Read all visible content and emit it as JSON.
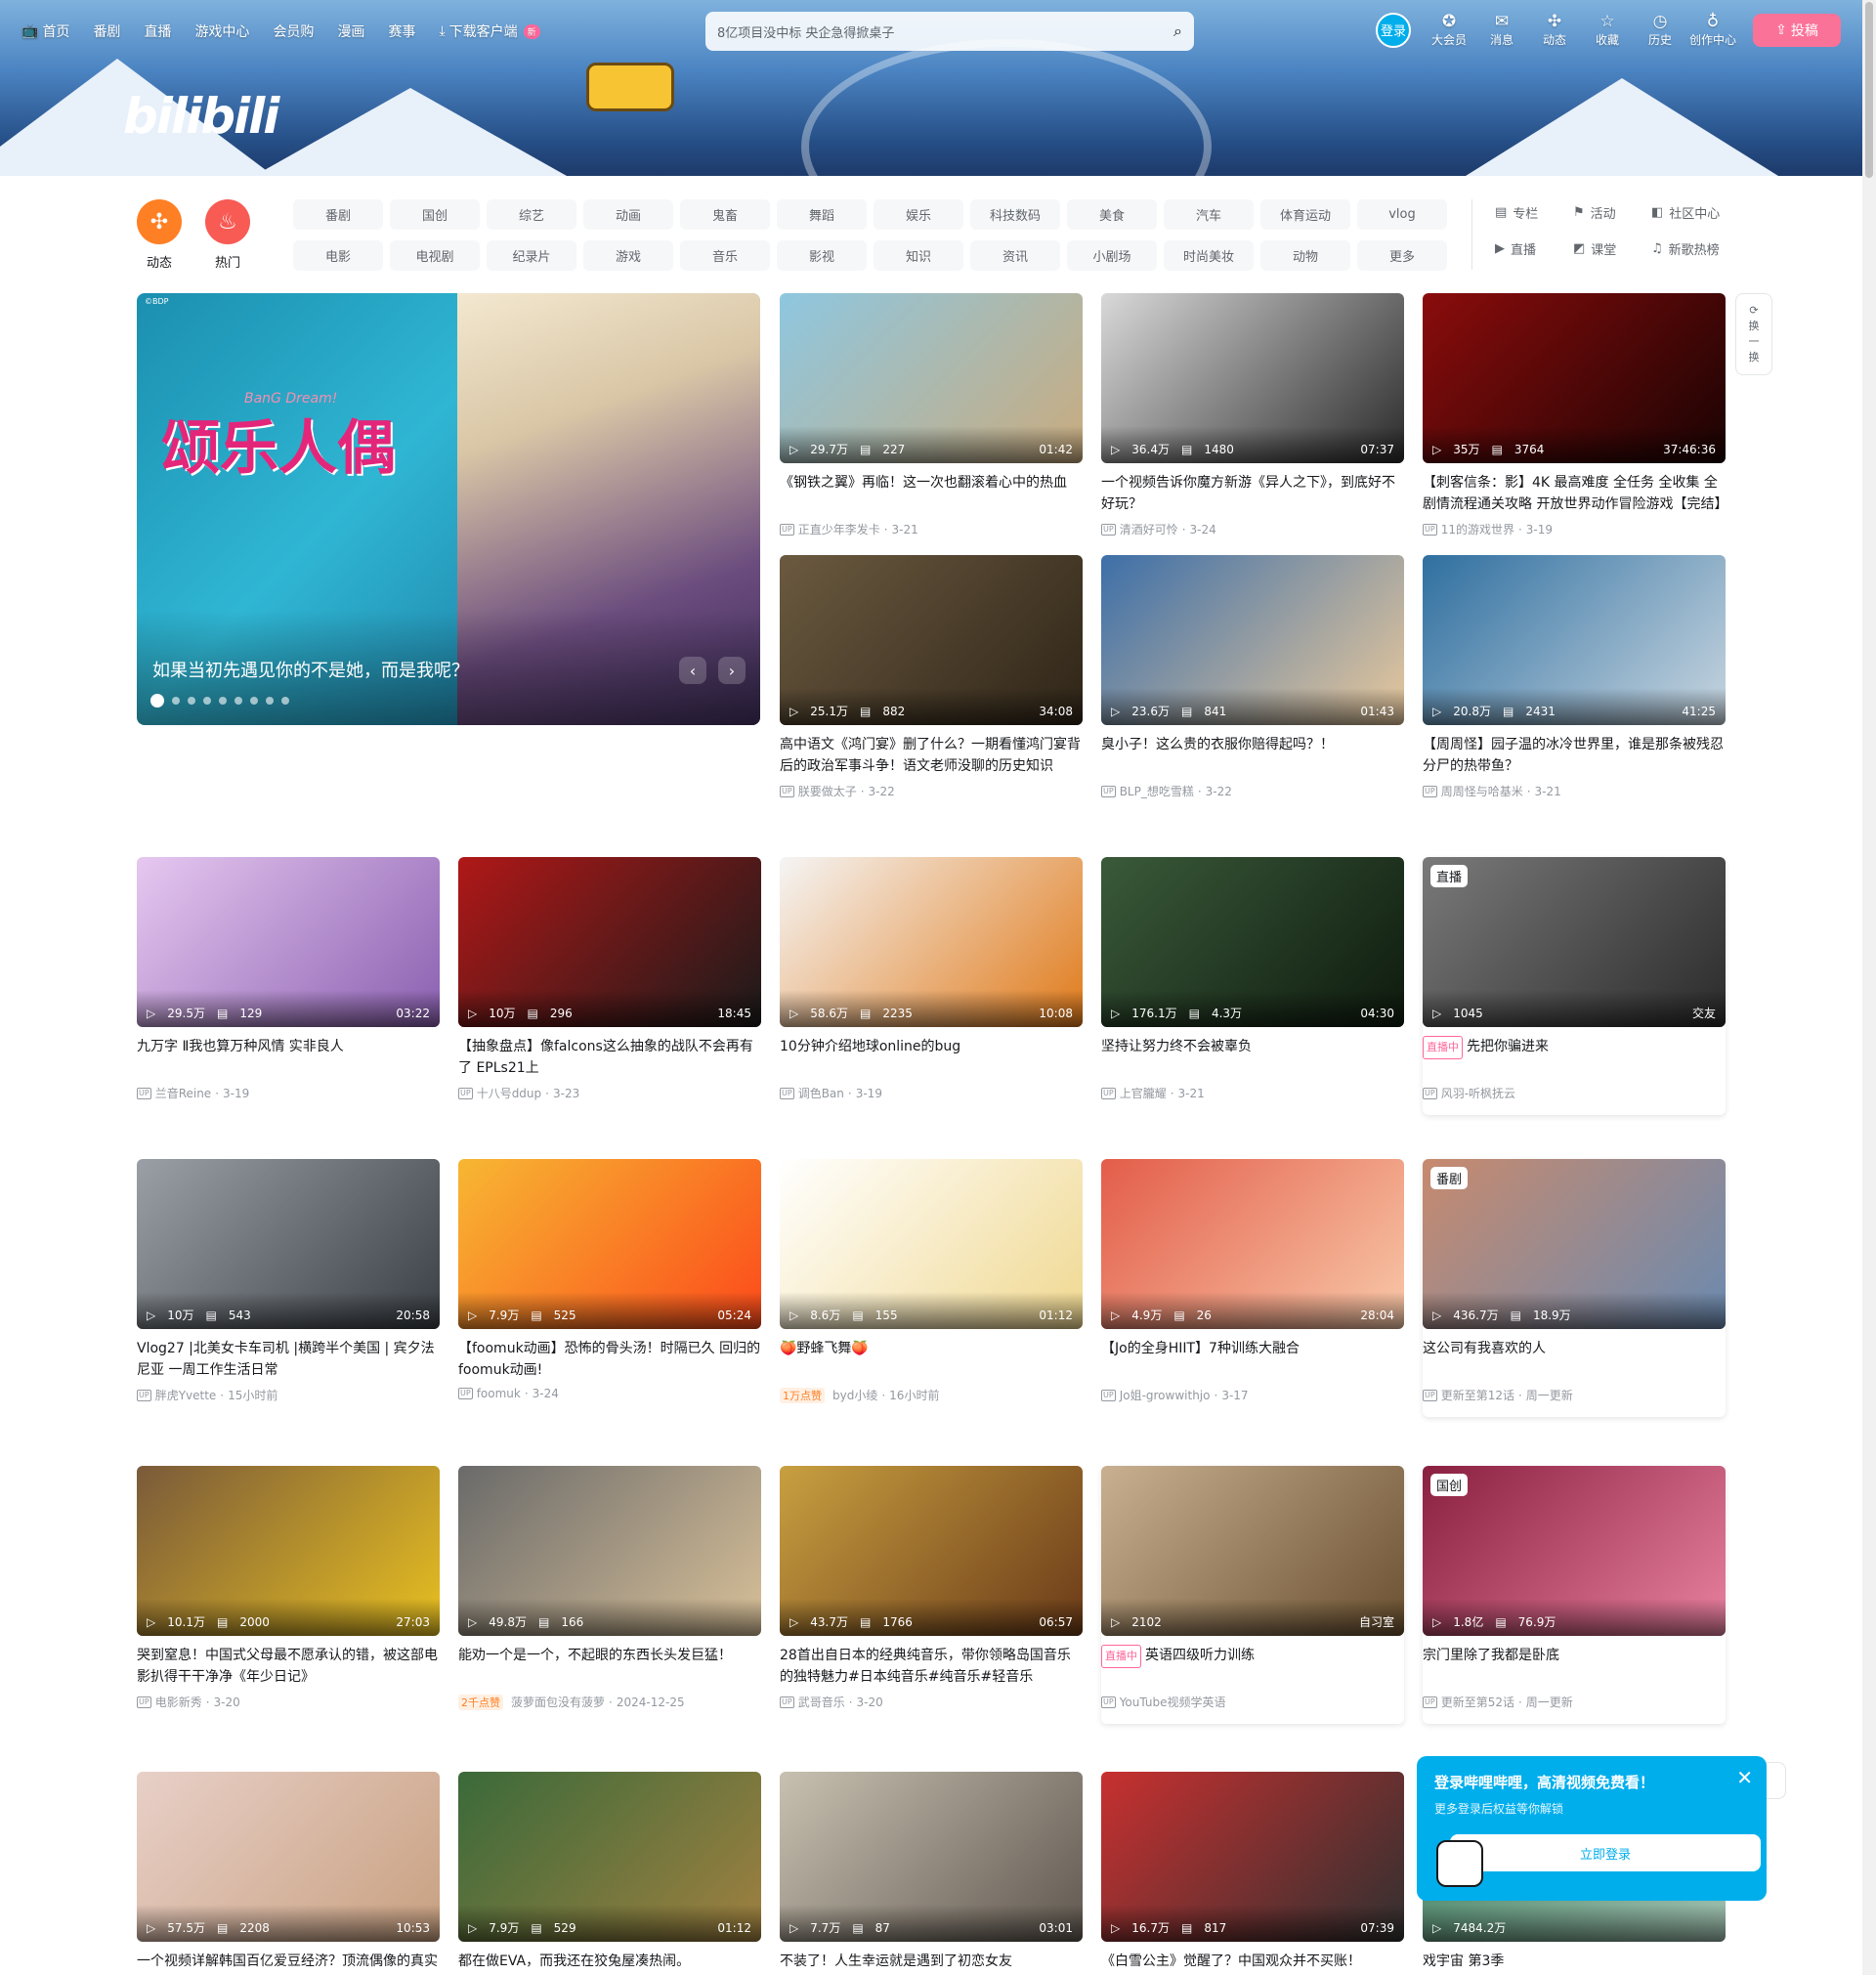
{
  "nav": {
    "items": [
      "首页",
      "番剧",
      "直播",
      "游戏中心",
      "会员购",
      "漫画",
      "赛事",
      "下载客户端"
    ],
    "new_badge": "新",
    "search_placeholder": "8亿项目没中标 央企急得掀桌子",
    "login": "登录",
    "right": [
      "大会员",
      "消息",
      "动态",
      "收藏",
      "历史",
      "创作中心"
    ],
    "upload": "投稿"
  },
  "logo": "bilibili",
  "quick": [
    {
      "label": "动态",
      "color": "#ff7f24",
      "icon": "✣"
    },
    {
      "label": "热门",
      "color": "#f85a54",
      "icon": "♨"
    }
  ],
  "categories": [
    "番剧",
    "国创",
    "综艺",
    "动画",
    "鬼畜",
    "舞蹈",
    "娱乐",
    "科技数码",
    "美食",
    "汽车",
    "体育运动",
    "vlog",
    "电影",
    "电视剧",
    "纪录片",
    "游戏",
    "音乐",
    "影视",
    "知识",
    "资讯",
    "小剧场",
    "时尚美妆",
    "动物",
    "更多"
  ],
  "links": [
    "专栏",
    "活动",
    "社区中心",
    "直播",
    "课堂",
    "新歌热榜"
  ],
  "banner": {
    "title": "如果当初先遇见你的不是她，而是我呢？",
    "art_text": "颂乐人偶",
    "art_sub": "BanG Dream!",
    "watermark": "©BDP",
    "prev": "‹",
    "next": "›"
  },
  "refresh": [
    "换",
    "一",
    "换"
  ],
  "cards": [
    {
      "views": "29.7万",
      "danmaku": "227",
      "duration": "01:42",
      "title": "《钢铁之翼》再临！这一次也翻滚着心中的热血",
      "author": "正直少年李发卡",
      "date": "3-21",
      "c1": "#8ec7e0",
      "c2": "#c9ab7e"
    },
    {
      "views": "36.4万",
      "danmaku": "1480",
      "duration": "07:37",
      "title": "一个视频告诉你魔方新游《异人之下》，到底好不好玩？",
      "author": "清酒好可怜",
      "date": "3-24",
      "c1": "#d9d9d9",
      "c2": "#2a2a2a"
    },
    {
      "views": "35万",
      "danmaku": "3764",
      "duration": "37:46:36",
      "title": "【刺客信条：影】4K 最高难度 全任务 全收集 全剧情流程通关攻略 开放世界动作冒险游戏【完结】",
      "author": "11的游戏世界",
      "date": "3-19",
      "c1": "#8b0c0c",
      "c2": "#1a0303"
    },
    {
      "views": "25.1万",
      "danmaku": "882",
      "duration": "34:08",
      "title": "高中语文《鸿门宴》删了什么？一期看懂鸿门宴背后的政治军事斗争！语文老师没聊的历史知识",
      "author": "朕要做太子",
      "date": "3-22",
      "c1": "#6b5a40",
      "c2": "#2e2417"
    },
    {
      "views": "23.6万",
      "danmaku": "841",
      "duration": "01:43",
      "title": "臭小子！这么贵的衣服你赔得起吗？！",
      "author": "BLP_想吃雪糕",
      "date": "3-22",
      "c1": "#3d6fa8",
      "c2": "#e8c89c"
    },
    {
      "views": "20.8万",
      "danmaku": "2431",
      "duration": "41:25",
      "title": "【周周怪】园子温的冰冷世界里，谁是那条被残忍分尸的热带鱼？",
      "author": "周周怪与哈基米",
      "date": "3-21",
      "c1": "#2f6fa0",
      "c2": "#c8d6e0"
    },
    {
      "views": "29.5万",
      "danmaku": "129",
      "duration": "03:22",
      "title": "九万字 Ⅱ我也算万种风情 实非良人",
      "author": "兰音Reine",
      "date": "3-19",
      "c1": "#e6c8f0",
      "c2": "#8a5fb0"
    },
    {
      "views": "10万",
      "danmaku": "296",
      "duration": "18:45",
      "title": "【抽象盘点】像falcons这么抽象的战队不会再有了 EPLs21上",
      "author": "十八号ddup",
      "date": "3-23",
      "c1": "#b01818",
      "c2": "#1a1a1a"
    },
    {
      "views": "58.6万",
      "danmaku": "2235",
      "duration": "10:08",
      "title": "10分钟介绍地球online的bug",
      "author": "调色Ban",
      "date": "3-19",
      "c1": "#f5f5f5",
      "c2": "#e07a1a"
    },
    {
      "views": "176.1万",
      "danmaku": "4.3万",
      "duration": "04:30",
      "title": "坚持让努力终不会被辜负",
      "author": "上官朧耀",
      "date": "3-21",
      "c1": "#3a5a3a",
      "c2": "#0e1a0e"
    },
    {
      "views": "1045",
      "danmaku": "",
      "duration": "交友",
      "title": "先把你骗进来",
      "author": "风羽-听枫抚云",
      "date": "",
      "live": "直播中",
      "badge": "直播",
      "c1": "#7a7a7a",
      "c2": "#2a2a2a"
    },
    {
      "views": "10万",
      "danmaku": "543",
      "duration": "20:58",
      "title": "Vlog27 |北美女卡车司机 |横跨半个美国 | 宾夕法尼亚 一周工作生活日常",
      "author": "胖虎Yvette",
      "date": "15小时前",
      "c1": "#9aa0a6",
      "c2": "#3a3f45"
    },
    {
      "views": "7.9万",
      "danmaku": "525",
      "duration": "05:24",
      "title": "【foomuk动画】恐怖的骨头汤！时隔已久 回归的foomuk动画!",
      "author": "foomuk",
      "date": "3-24",
      "c1": "#f7b733",
      "c2": "#fc4a1a"
    },
    {
      "views": "8.6万",
      "danmaku": "155",
      "duration": "01:12",
      "title": "🍑野蜂飞舞🍑",
      "author": "byd小绫",
      "date": "16小时前",
      "like": "1万点赞",
      "c1": "#ffffff",
      "c2": "#f0d890"
    },
    {
      "views": "4.9万",
      "danmaku": "26",
      "duration": "28:04",
      "title": "【Jo的全身HIIT】7种训练大融合",
      "author": "Jo姐-growwithjo",
      "date": "3-17",
      "c1": "#e35d4a",
      "c2": "#f8c8a8"
    },
    {
      "views": "436.7万",
      "danmaku": "18.9万",
      "duration": "",
      "title": "这公司有我喜欢的人",
      "author": "更新至第12话",
      "date": "周一更新",
      "badge": "番剧",
      "c1": "#c88a6e",
      "c2": "#6a8ab0"
    },
    {
      "views": "10.1万",
      "danmaku": "2000",
      "duration": "27:03",
      "title": "哭到窒息！中国式父母最不愿承认的错，被这部电影扒得干干净净《年少日记》",
      "author": "电影新秀",
      "date": "3-20",
      "c1": "#7a5a3a",
      "c2": "#e8c020"
    },
    {
      "views": "49.8万",
      "danmaku": "166",
      "duration": "",
      "title": "能劝一个是一个，不起眼的东西长头发巨猛！",
      "author": "菠萝面包没有菠萝",
      "date": "2024-12-25",
      "like": "2千点赞",
      "c1": "#6a6a6a",
      "c2": "#d8c098"
    },
    {
      "views": "43.7万",
      "danmaku": "1766",
      "duration": "06:57",
      "title": "28首出自日本的经典纯音乐，带你领略岛国音乐的独特魅力#日本纯音乐#纯音乐#轻音乐",
      "author": "武哥音乐",
      "date": "3-20",
      "c1": "#c8a040",
      "c2": "#6a3a18"
    },
    {
      "views": "2102",
      "danmaku": "",
      "duration": "自习室",
      "title": "英语四级听力训练",
      "author": "YouTube视频学英语",
      "date": "",
      "live": "直播中",
      "c1": "#c8b090",
      "c2": "#6a5030"
    },
    {
      "views": "1.8亿",
      "danmaku": "76.9万",
      "duration": "",
      "title": "宗门里除了我都是卧底",
      "author": "更新至第52话",
      "date": "周一更新",
      "badge": "国创",
      "c1": "#8a2040",
      "c2": "#e880a0"
    },
    {
      "views": "57.5万",
      "danmaku": "2208",
      "duration": "10:53",
      "title": "一个视频详解韩国百亿爱豆经济？顶流偶像的真实收入…",
      "author": "",
      "date": "",
      "c1": "#e8d0c8",
      "c2": "#c8a080"
    },
    {
      "views": "7.9万",
      "danmaku": "529",
      "duration": "01:12",
      "title": "都在做EVA，而我还在狡兔屋凑热闹。",
      "author": "",
      "date": "",
      "c1": "#3a6a3a",
      "c2": "#a08040"
    },
    {
      "views": "7.7万",
      "danmaku": "87",
      "duration": "03:01",
      "title": "不装了！人生幸运就是遇到了初恋女友",
      "author": "",
      "date": "",
      "c1": "#c8c0b0",
      "c2": "#605850"
    },
    {
      "views": "16.7万",
      "danmaku": "817",
      "duration": "07:39",
      "title": "《白雪公主》觉醒了？中国观众并不买账！",
      "author": "",
      "date": "",
      "c1": "#c83030",
      "c2": "#303030"
    },
    {
      "views": "7484.2万",
      "danmaku": "",
      "duration": "",
      "title": "戏宇宙 第3季",
      "author": "",
      "date": "",
      "c1": "#408060",
      "c2": "#a0c0b0"
    }
  ],
  "popup": {
    "title": "登录哔哩哔哩，高清视频免费看！",
    "sub": "更多登录后权益等你解锁",
    "button": "立即登录",
    "close": "✕"
  }
}
